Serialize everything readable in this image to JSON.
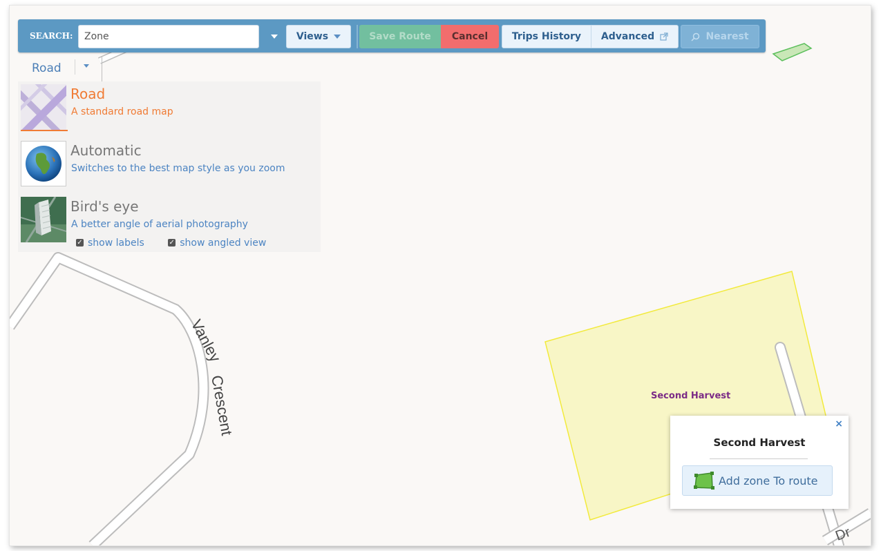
{
  "toolbar": {
    "search_label": "SEARCH:",
    "search_value": "Zone",
    "views_label": "Views",
    "save_route_label": "Save Route",
    "cancel_label": "Cancel",
    "trips_history_label": "Trips History",
    "advanced_label": "Advanced",
    "nearest_label": "Nearest",
    "icons": {
      "search_dropdown": "chevron-down-icon",
      "views_dropdown": "chevron-down-icon",
      "advanced": "external-link-icon",
      "nearest": "search-icon"
    },
    "colors": {
      "bar": "#5c99c3",
      "save": "#72bf9f",
      "cancel": "#f26d6d"
    }
  },
  "map_style": {
    "current": "Road",
    "options": [
      {
        "title": "Road",
        "description": "A standard road map",
        "selected": true,
        "icon": "road-map-thumbnail"
      },
      {
        "title": "Automatic",
        "description": "Switches to the best map style as you zoom",
        "selected": false,
        "icon": "globe-thumbnail"
      },
      {
        "title": "Bird's eye",
        "description": "A better angle of aerial photography",
        "selected": false,
        "icon": "aerial-building-thumbnail"
      }
    ],
    "checkboxes": [
      {
        "label": "show labels",
        "checked": true
      },
      {
        "label": "show angled view",
        "checked": true
      }
    ],
    "accent_color": "#f07b34"
  },
  "map": {
    "street_labels": [
      "Vanley Crescent",
      "Dr"
    ],
    "zone_label": "Second Harvest",
    "zone_fill": "#f8f6c6",
    "zone_stroke": "#f2ea3c"
  },
  "popup": {
    "title": "Second Harvest",
    "close": "×",
    "add_button_label": "Add zone To route",
    "add_icon": "zone-shape-icon"
  }
}
